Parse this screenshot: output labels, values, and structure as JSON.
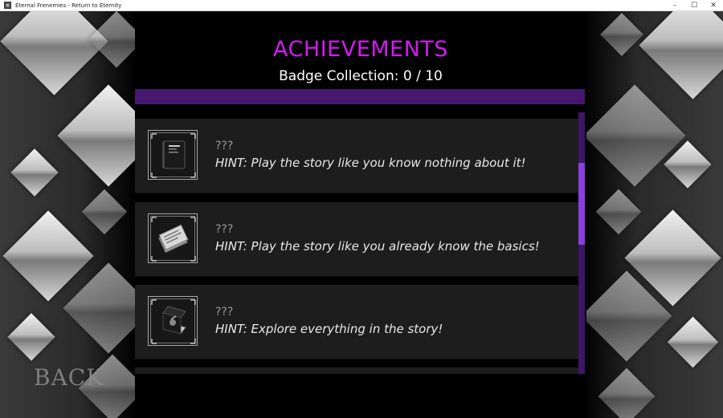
{
  "window": {
    "title": "Eternal Frenemies - Return to Eternity",
    "minimize": "–",
    "maximize": "☐",
    "close": "✕"
  },
  "screen": {
    "heading": "ACHIEVEMENTS",
    "collection_label": "Badge Collection: 0 / 10"
  },
  "achievements": [
    {
      "name": "???",
      "hint": "HINT: Play the story like you know nothing about it!",
      "icon": "notebook-icon"
    },
    {
      "name": "???",
      "hint": "HINT: Play the story like you already know the basics!",
      "icon": "papers-icon"
    },
    {
      "name": "???",
      "hint": "HINT: Explore everything in the story!",
      "icon": "book-icon"
    }
  ],
  "back_label": "BACK",
  "colors": {
    "heading": "#d21bf0",
    "accent_bar": "#45186d",
    "scroll_thumb": "#8a3ee0"
  }
}
